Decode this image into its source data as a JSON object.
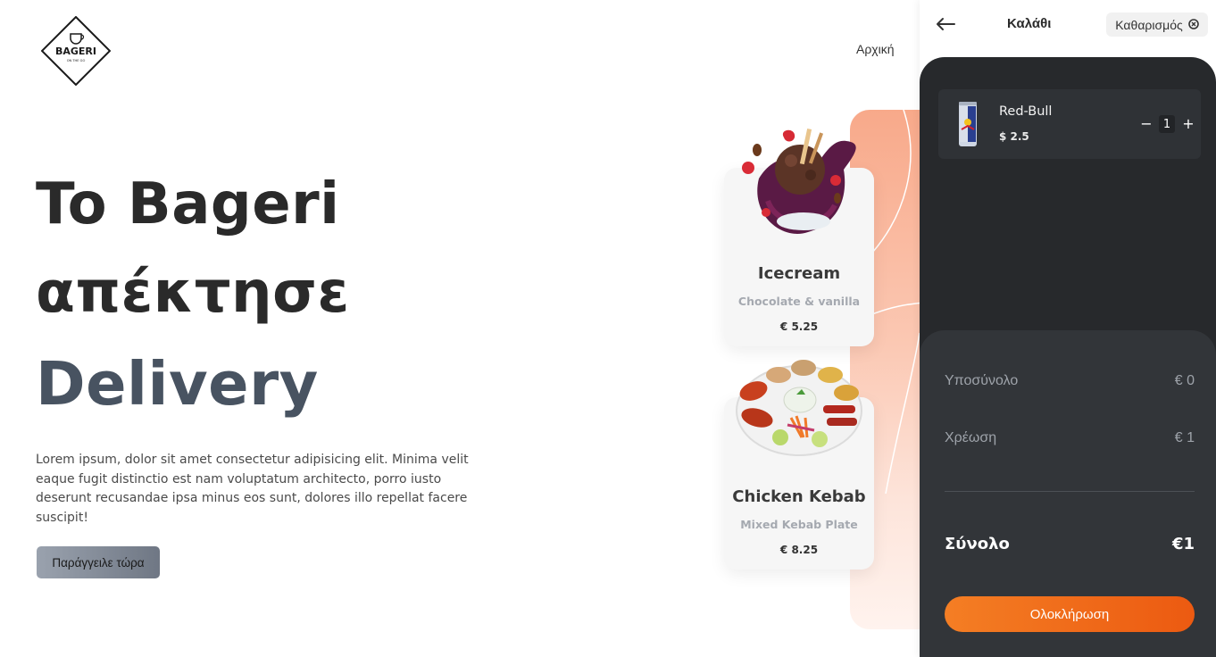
{
  "brand": {
    "logo_text": "BAGERI",
    "logo_subtext": "ON THE GO"
  },
  "nav": {
    "home_label": "Αρχική"
  },
  "hero": {
    "line1": "To Bageri",
    "line2": "απέκτησε",
    "line3": "Delivery",
    "description": "Lorem ipsum, dolor sit amet consectetur adipisicing elit. Minima velit eaque fugit distinctio est nam voluptatum architecto, porro iusto deserunt recusandae ipsa minus eos sunt, dolores illo repellat facere suscipit!",
    "cta_label": "Παράγγειλε τώρα"
  },
  "showcase": {
    "items": [
      {
        "name": "Icecream",
        "description": "Chocolate & vanilla",
        "price": "€ 5.25"
      },
      {
        "name": "Chicken Kebab",
        "description": "Mixed Kebab Plate",
        "price": "€ 8.25"
      }
    ]
  },
  "cart": {
    "title": "Καλάθι",
    "clear_label": "Καθαρισμός",
    "items": [
      {
        "name": "Red-Bull",
        "price": "$ 2.5",
        "quantity": "1"
      }
    ],
    "subtotal_label": "Υποσύνολο",
    "subtotal_value": "€ 0",
    "fee_label": "Χρέωση",
    "fee_value": "€ 1",
    "total_label": "Σύνολο",
    "total_value": "€1",
    "checkout_label": "Ολοκλήρωση"
  },
  "colors": {
    "accent_orange": "#f47e24",
    "dark_panel": "#27292c",
    "hero_accent": "#485361",
    "peach": "#f8a98a"
  }
}
